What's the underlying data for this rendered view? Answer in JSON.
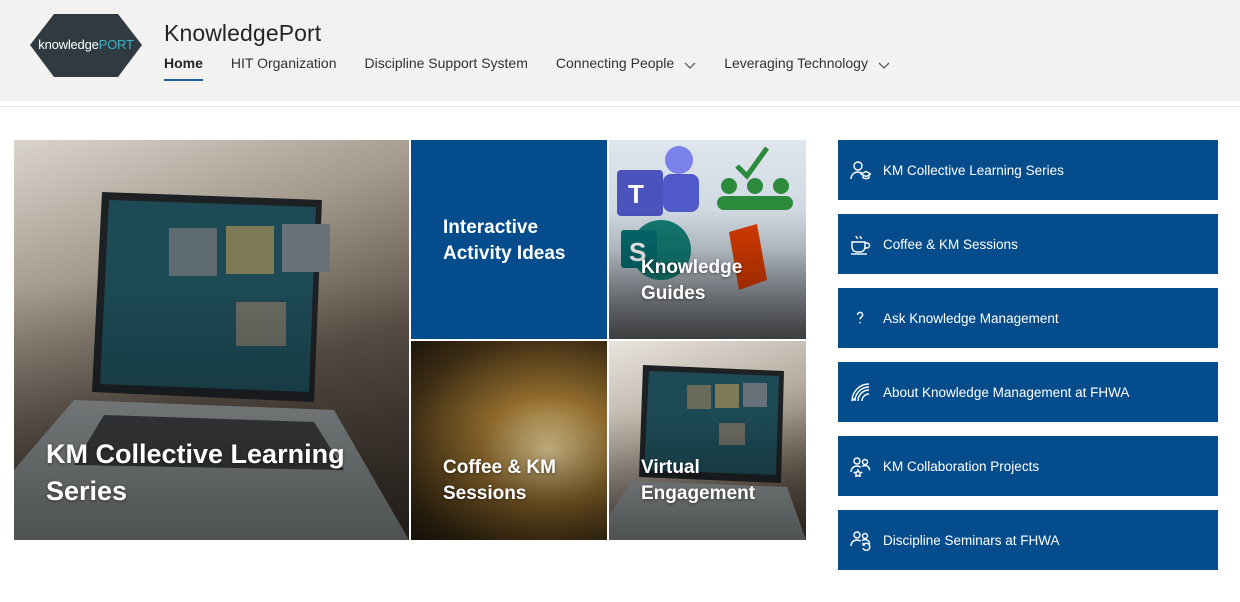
{
  "header": {
    "logo": {
      "text_a": "knowledge",
      "text_b": "PORT"
    },
    "site_title": "KnowledgePort",
    "nav": [
      {
        "label": "Home",
        "active": true,
        "has_dropdown": false
      },
      {
        "label": "HIT Organization",
        "active": false,
        "has_dropdown": false
      },
      {
        "label": "Discipline Support System",
        "active": false,
        "has_dropdown": false
      },
      {
        "label": "Connecting People",
        "active": false,
        "has_dropdown": true
      },
      {
        "label": "Leveraging Technology",
        "active": false,
        "has_dropdown": true
      }
    ]
  },
  "tiles": {
    "km_collective": {
      "label": "KM Collective Learning Series"
    },
    "interactive": {
      "label": "Interactive Activity Ideas"
    },
    "guides": {
      "label": "Knowledge Guides"
    },
    "coffee": {
      "label": "Coffee & KM Sessions"
    },
    "virtual": {
      "label": "Virtual Engagement"
    }
  },
  "quick_links": [
    {
      "label": "KM Collective Learning Series",
      "icon": "learner-icon"
    },
    {
      "label": "Coffee & KM Sessions",
      "icon": "coffee-cup-icon"
    },
    {
      "label": "Ask Knowledge Management",
      "icon": "question-mark-icon"
    },
    {
      "label": "About Knowledge Management at FHWA",
      "icon": "signal-hand-icon"
    },
    {
      "label": "KM Collaboration Projects",
      "icon": "people-star-icon"
    },
    {
      "label": "Discipline Seminars at FHWA",
      "icon": "people-refresh-icon"
    }
  ],
  "colors": {
    "brand_blue": "#044c8c",
    "accent_underline": "#1f5d95",
    "header_bg": "#f3f2f1"
  }
}
